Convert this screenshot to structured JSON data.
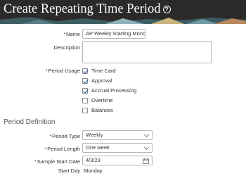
{
  "header": {
    "title": "Create Repeating Time Period",
    "help_icon": "help-circle-icon",
    "background": "#2b2a28"
  },
  "form": {
    "name": {
      "label": "Name",
      "required": true,
      "value": "AP Weekly Starting Monda"
    },
    "description": {
      "label": "Description",
      "value": ""
    },
    "period_usage": {
      "label": "Period Usage",
      "required": true,
      "options": [
        {
          "label": "Time Card",
          "checked": true
        },
        {
          "label": "Approval",
          "checked": true
        },
        {
          "label": "Accrual Processing",
          "checked": true
        },
        {
          "label": "Overtime",
          "checked": false
        },
        {
          "label": "Balances",
          "checked": false
        }
      ]
    }
  },
  "period_definition": {
    "section_title": "Period Definition",
    "period_type": {
      "label": "Period Type",
      "required": true,
      "value": "Weekly"
    },
    "period_length": {
      "label": "Period Length",
      "required": true,
      "value": "One week"
    },
    "sample_start_date": {
      "label": "Sample Start Date",
      "required": true,
      "value": "4/3/23",
      "icon": "calendar-icon"
    },
    "start_day": {
      "label": "Start Day",
      "value": "Monday"
    }
  },
  "colors": {
    "required_marker": "#8a2b2b",
    "check": "#1f4f8f"
  }
}
